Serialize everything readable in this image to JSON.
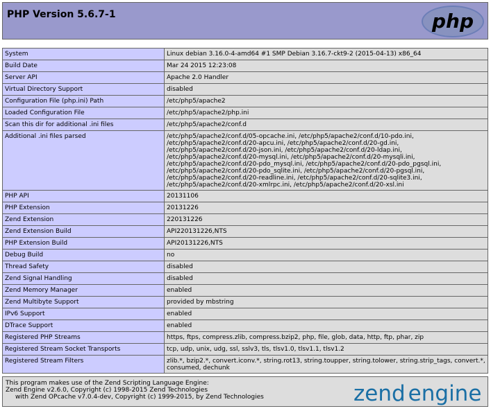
{
  "header": {
    "title": "PHP Version 5.6.7-1",
    "logo_text": "php",
    "logo_color": "#6c7eb7"
  },
  "rows": [
    {
      "key": "System",
      "value": "Linux debian 3.16.0-4-amd64 #1 SMP Debian 3.16.7-ckt9-2 (2015-04-13) x86_64"
    },
    {
      "key": "Build Date",
      "value": "Mar 24 2015 12:23:08"
    },
    {
      "key": "Server API",
      "value": "Apache 2.0 Handler"
    },
    {
      "key": "Virtual Directory Support",
      "value": "disabled"
    },
    {
      "key": "Configuration File (php.ini) Path",
      "value": "/etc/php5/apache2"
    },
    {
      "key": "Loaded Configuration File",
      "value": "/etc/php5/apache2/php.ini"
    },
    {
      "key": "Scan this dir for additional .ini files",
      "value": "/etc/php5/apache2/conf.d"
    },
    {
      "key": "Additional .ini files parsed",
      "value": "/etc/php5/apache2/conf.d/05-opcache.ini, /etc/php5/apache2/conf.d/10-pdo.ini, /etc/php5/apache2/conf.d/20-apcu.ini, /etc/php5/apache2/conf.d/20-gd.ini, /etc/php5/apache2/conf.d/20-json.ini, /etc/php5/apache2/conf.d/20-ldap.ini, /etc/php5/apache2/conf.d/20-mysql.ini, /etc/php5/apache2/conf.d/20-mysqli.ini, /etc/php5/apache2/conf.d/20-pdo_mysql.ini, /etc/php5/apache2/conf.d/20-pdo_pgsql.ini, /etc/php5/apache2/conf.d/20-pdo_sqlite.ini, /etc/php5/apache2/conf.d/20-pgsql.ini, /etc/php5/apache2/conf.d/20-readline.ini, /etc/php5/apache2/conf.d/20-sqlite3.ini, /etc/php5/apache2/conf.d/20-xmlrpc.ini, /etc/php5/apache2/conf.d/20-xsl.ini"
    },
    {
      "key": "PHP API",
      "value": "20131106"
    },
    {
      "key": "PHP Extension",
      "value": "20131226"
    },
    {
      "key": "Zend Extension",
      "value": "220131226"
    },
    {
      "key": "Zend Extension Build",
      "value": "API220131226,NTS"
    },
    {
      "key": "PHP Extension Build",
      "value": "API20131226,NTS"
    },
    {
      "key": "Debug Build",
      "value": "no"
    },
    {
      "key": "Thread Safety",
      "value": "disabled"
    },
    {
      "key": "Zend Signal Handling",
      "value": "disabled"
    },
    {
      "key": "Zend Memory Manager",
      "value": "enabled"
    },
    {
      "key": "Zend Multibyte Support",
      "value": "provided by mbstring"
    },
    {
      "key": "IPv6 Support",
      "value": "enabled"
    },
    {
      "key": "DTrace Support",
      "value": "enabled"
    },
    {
      "key": "Registered PHP Streams",
      "value": "https, ftps, compress.zlib, compress.bzip2, php, file, glob, data, http, ftp, phar, zip"
    },
    {
      "key": "Registered Stream Socket Transports",
      "value": "tcp, udp, unix, udg, ssl, sslv3, tls, tlsv1.0, tlsv1.1, tlsv1.2"
    },
    {
      "key": "Registered Stream Filters",
      "value": "zlib.*, bzip2.*, convert.iconv.*, string.rot13, string.toupper, string.tolower, string.strip_tags, convert.*, consumed, dechunk"
    }
  ],
  "footer": {
    "line1": "This program makes use of the Zend Scripting Language Engine:",
    "line2": "Zend Engine v2.6.0, Copyright (c) 1998-2015 Zend Technologies",
    "line3": "with Zend OPcache v7.0.4-dev, Copyright (c) 1999-2015, by Zend Technologies",
    "logo_word1": "zend",
    "logo_word2": "engine",
    "logo_color1": "#1a6fa5",
    "logo_color2": "#1a6fa5"
  }
}
